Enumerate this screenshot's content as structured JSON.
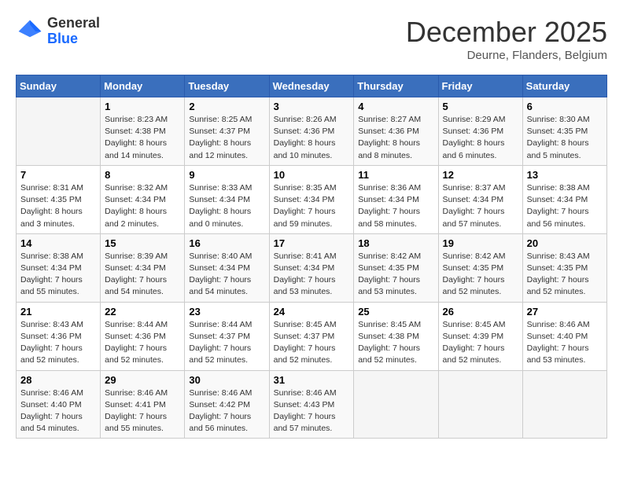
{
  "header": {
    "logo": {
      "general": "General",
      "blue": "Blue"
    },
    "title": "December 2025",
    "location": "Deurne, Flanders, Belgium"
  },
  "calendar": {
    "days_of_week": [
      "Sunday",
      "Monday",
      "Tuesday",
      "Wednesday",
      "Thursday",
      "Friday",
      "Saturday"
    ],
    "weeks": [
      [
        {
          "day": "",
          "sunrise": "",
          "sunset": "",
          "daylight": ""
        },
        {
          "day": "1",
          "sunrise": "Sunrise: 8:23 AM",
          "sunset": "Sunset: 4:38 PM",
          "daylight": "Daylight: 8 hours and 14 minutes."
        },
        {
          "day": "2",
          "sunrise": "Sunrise: 8:25 AM",
          "sunset": "Sunset: 4:37 PM",
          "daylight": "Daylight: 8 hours and 12 minutes."
        },
        {
          "day": "3",
          "sunrise": "Sunrise: 8:26 AM",
          "sunset": "Sunset: 4:36 PM",
          "daylight": "Daylight: 8 hours and 10 minutes."
        },
        {
          "day": "4",
          "sunrise": "Sunrise: 8:27 AM",
          "sunset": "Sunset: 4:36 PM",
          "daylight": "Daylight: 8 hours and 8 minutes."
        },
        {
          "day": "5",
          "sunrise": "Sunrise: 8:29 AM",
          "sunset": "Sunset: 4:36 PM",
          "daylight": "Daylight: 8 hours and 6 minutes."
        },
        {
          "day": "6",
          "sunrise": "Sunrise: 8:30 AM",
          "sunset": "Sunset: 4:35 PM",
          "daylight": "Daylight: 8 hours and 5 minutes."
        }
      ],
      [
        {
          "day": "7",
          "sunrise": "Sunrise: 8:31 AM",
          "sunset": "Sunset: 4:35 PM",
          "daylight": "Daylight: 8 hours and 3 minutes."
        },
        {
          "day": "8",
          "sunrise": "Sunrise: 8:32 AM",
          "sunset": "Sunset: 4:34 PM",
          "daylight": "Daylight: 8 hours and 2 minutes."
        },
        {
          "day": "9",
          "sunrise": "Sunrise: 8:33 AM",
          "sunset": "Sunset: 4:34 PM",
          "daylight": "Daylight: 8 hours and 0 minutes."
        },
        {
          "day": "10",
          "sunrise": "Sunrise: 8:35 AM",
          "sunset": "Sunset: 4:34 PM",
          "daylight": "Daylight: 7 hours and 59 minutes."
        },
        {
          "day": "11",
          "sunrise": "Sunrise: 8:36 AM",
          "sunset": "Sunset: 4:34 PM",
          "daylight": "Daylight: 7 hours and 58 minutes."
        },
        {
          "day": "12",
          "sunrise": "Sunrise: 8:37 AM",
          "sunset": "Sunset: 4:34 PM",
          "daylight": "Daylight: 7 hours and 57 minutes."
        },
        {
          "day": "13",
          "sunrise": "Sunrise: 8:38 AM",
          "sunset": "Sunset: 4:34 PM",
          "daylight": "Daylight: 7 hours and 56 minutes."
        }
      ],
      [
        {
          "day": "14",
          "sunrise": "Sunrise: 8:38 AM",
          "sunset": "Sunset: 4:34 PM",
          "daylight": "Daylight: 7 hours and 55 minutes."
        },
        {
          "day": "15",
          "sunrise": "Sunrise: 8:39 AM",
          "sunset": "Sunset: 4:34 PM",
          "daylight": "Daylight: 7 hours and 54 minutes."
        },
        {
          "day": "16",
          "sunrise": "Sunrise: 8:40 AM",
          "sunset": "Sunset: 4:34 PM",
          "daylight": "Daylight: 7 hours and 54 minutes."
        },
        {
          "day": "17",
          "sunrise": "Sunrise: 8:41 AM",
          "sunset": "Sunset: 4:34 PM",
          "daylight": "Daylight: 7 hours and 53 minutes."
        },
        {
          "day": "18",
          "sunrise": "Sunrise: 8:42 AM",
          "sunset": "Sunset: 4:35 PM",
          "daylight": "Daylight: 7 hours and 53 minutes."
        },
        {
          "day": "19",
          "sunrise": "Sunrise: 8:42 AM",
          "sunset": "Sunset: 4:35 PM",
          "daylight": "Daylight: 7 hours and 52 minutes."
        },
        {
          "day": "20",
          "sunrise": "Sunrise: 8:43 AM",
          "sunset": "Sunset: 4:35 PM",
          "daylight": "Daylight: 7 hours and 52 minutes."
        }
      ],
      [
        {
          "day": "21",
          "sunrise": "Sunrise: 8:43 AM",
          "sunset": "Sunset: 4:36 PM",
          "daylight": "Daylight: 7 hours and 52 minutes."
        },
        {
          "day": "22",
          "sunrise": "Sunrise: 8:44 AM",
          "sunset": "Sunset: 4:36 PM",
          "daylight": "Daylight: 7 hours and 52 minutes."
        },
        {
          "day": "23",
          "sunrise": "Sunrise: 8:44 AM",
          "sunset": "Sunset: 4:37 PM",
          "daylight": "Daylight: 7 hours and 52 minutes."
        },
        {
          "day": "24",
          "sunrise": "Sunrise: 8:45 AM",
          "sunset": "Sunset: 4:37 PM",
          "daylight": "Daylight: 7 hours and 52 minutes."
        },
        {
          "day": "25",
          "sunrise": "Sunrise: 8:45 AM",
          "sunset": "Sunset: 4:38 PM",
          "daylight": "Daylight: 7 hours and 52 minutes."
        },
        {
          "day": "26",
          "sunrise": "Sunrise: 8:45 AM",
          "sunset": "Sunset: 4:39 PM",
          "daylight": "Daylight: 7 hours and 52 minutes."
        },
        {
          "day": "27",
          "sunrise": "Sunrise: 8:46 AM",
          "sunset": "Sunset: 4:40 PM",
          "daylight": "Daylight: 7 hours and 53 minutes."
        }
      ],
      [
        {
          "day": "28",
          "sunrise": "Sunrise: 8:46 AM",
          "sunset": "Sunset: 4:40 PM",
          "daylight": "Daylight: 7 hours and 54 minutes."
        },
        {
          "day": "29",
          "sunrise": "Sunrise: 8:46 AM",
          "sunset": "Sunset: 4:41 PM",
          "daylight": "Daylight: 7 hours and 55 minutes."
        },
        {
          "day": "30",
          "sunrise": "Sunrise: 8:46 AM",
          "sunset": "Sunset: 4:42 PM",
          "daylight": "Daylight: 7 hours and 56 minutes."
        },
        {
          "day": "31",
          "sunrise": "Sunrise: 8:46 AM",
          "sunset": "Sunset: 4:43 PM",
          "daylight": "Daylight: 7 hours and 57 minutes."
        },
        {
          "day": "",
          "sunrise": "",
          "sunset": "",
          "daylight": ""
        },
        {
          "day": "",
          "sunrise": "",
          "sunset": "",
          "daylight": ""
        },
        {
          "day": "",
          "sunrise": "",
          "sunset": "",
          "daylight": ""
        }
      ]
    ]
  }
}
